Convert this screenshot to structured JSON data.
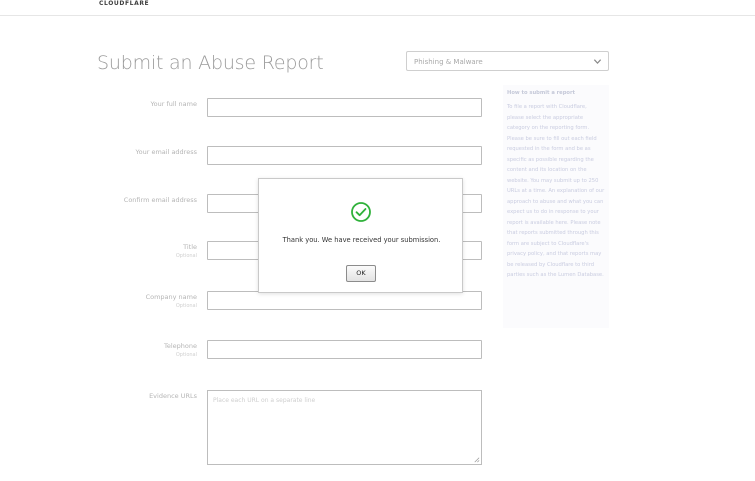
{
  "header": {
    "logo_text": "CLOUDFLARE"
  },
  "page": {
    "title": "Submit an Abuse Report"
  },
  "category": {
    "selected": "Phishing & Malware"
  },
  "form": {
    "full_name_label": "Your full name",
    "email_label": "Your email address",
    "confirm_email_label": "Confirm email address",
    "title_label": "Title",
    "title_sub": "Optional",
    "company_label": "Company name",
    "company_sub": "Optional",
    "telephone_label": "Telephone",
    "telephone_sub": "Optional",
    "evidence_label": "Evidence URLs",
    "evidence_placeholder": "Place each URL on a separate line"
  },
  "sidebar": {
    "heading": "How to submit a report",
    "body": "To file a report with Cloudflare, please select the appropriate category on the reporting form. Please be sure to fill out each field requested in the form and be as specific as possible regarding the content and its location on the website. You may submit up to 250 URLs at a time. An explanation of our approach to abuse and what you can expect us to do in response to your report is available here. Please note that reports submitted through this form are subject to Cloudflare's privacy policy, and that reports may be released by Cloudflare to third parties such as the Lumen Database."
  },
  "modal": {
    "message": "Thank you. We have received your submission.",
    "ok_label": "OK",
    "icon": "check-circle-icon",
    "icon_color": "#2fb13a"
  }
}
